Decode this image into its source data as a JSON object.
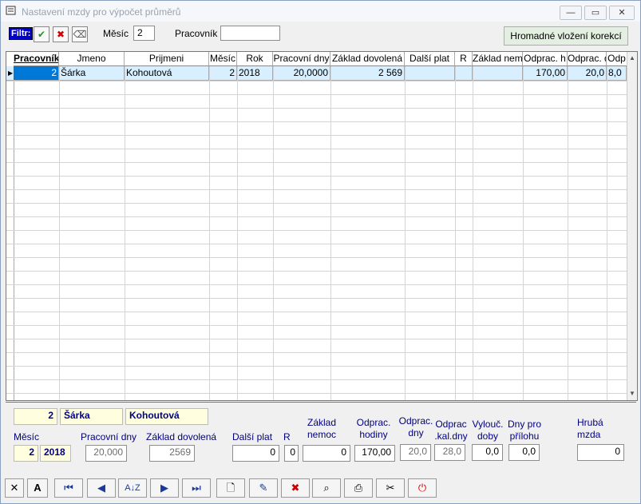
{
  "window": {
    "title": "Nastavení mzdy pro výpočet průměrů",
    "minimize_icon": "minimize-icon",
    "restore_icon": "restore-icon",
    "close_icon": "close-icon"
  },
  "filter": {
    "label": "Filtr:",
    "mesic_label": "Měsíc",
    "mesic_value": "2",
    "pracovnik_label": "Pracovník",
    "pracovnik_value": "",
    "bulk_button": "Hromadné vložení korekcí"
  },
  "grid": {
    "columns": [
      "Pracovník",
      "Jmeno",
      "Prijmeni",
      "Měsíc",
      "Rok",
      "Pracovní dny",
      "Základ dovolená",
      "Další plat",
      "R",
      "Základ nemoc",
      "Odprac. hodiny",
      "Odprac. dny",
      "Odp"
    ],
    "header_texts": [
      "Pracovník",
      "Jmeno",
      "Prijmeni",
      "Měsíc",
      "Rok",
      "Pracovní dny",
      "Základ dovolená",
      "Další plat",
      "R",
      "Základ nem",
      "Odprac. h",
      "Odprac. d",
      "Odp"
    ],
    "rows": [
      [
        "2",
        "Šárka",
        "Kohoutová",
        "2",
        "2018",
        "20,0000",
        "2 569",
        "",
        "",
        "",
        "170,00",
        "20,0",
        "8,0"
      ]
    ]
  },
  "detail": {
    "pracovnik": "2",
    "jmeno": "Šárka",
    "prijmeni": "Kohoutová",
    "mesic_label": "Měsíc",
    "mesic": "2",
    "rok": "2018",
    "pracovni_dny_label": "Pracovní dny",
    "pracovni_dny": "20,000",
    "zaklad_dovolena_label": "Základ dovolená",
    "zaklad_dovolena": "2569",
    "dalsi_plat_label": "Další plat",
    "dalsi_plat": "0",
    "r_label": "R",
    "r": "0",
    "zaklad_nemoc_label": "Základ nemoc",
    "zaklad_nemoc": "0",
    "odprac_hodiny_label": "Odprac. hodiny",
    "odprac_hodiny": "170,00",
    "odprac_dny_label": "Odprac. dny",
    "odprac_dny": "20,0",
    "odprac_kal_dny_label": "Odprac .kal.dny",
    "odprac_kal_dny": "28,0",
    "vylouc_doby_label": "Vylouč. doby",
    "vylouc_doby": "0,0",
    "dny_pro_prilohu_label": "Dny pro přílohu",
    "dny_pro_prilohu": "0,0",
    "hruba_mzda_label": "Hrubá mzda",
    "hruba_mzda": "0"
  },
  "toolbar": {
    "icons": [
      "close-icon",
      "font-icon",
      "first-record-icon",
      "previous-record-icon",
      "sort-icon",
      "next-record-icon",
      "last-record-icon",
      "new-record-icon",
      "edit-record-icon",
      "delete-record-icon",
      "find-icon",
      "print-icon",
      "tools-icon",
      "power-icon"
    ]
  }
}
